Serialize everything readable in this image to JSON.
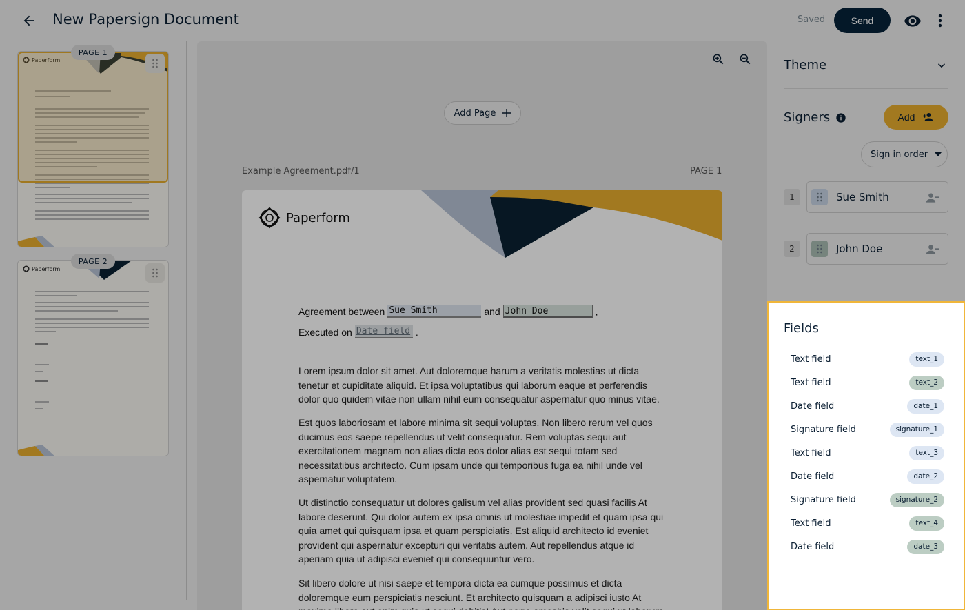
{
  "header": {
    "title": "New Papersign Document",
    "saved": "Saved",
    "send_label": "Send"
  },
  "thumbnails": [
    {
      "pill": "PAGE 1",
      "brand": "Paperform"
    },
    {
      "pill": "PAGE 2",
      "brand": "Paperform"
    }
  ],
  "viewer": {
    "add_page_label": "Add Page",
    "file_label": "Example Agreement.pdf/1",
    "page_label": "PAGE 1",
    "brand": "Paperform",
    "agreement_prefix": "Agreement between",
    "agreement_and": "and",
    "agreement_suffix": ",",
    "field_signer1": "Sue Smith",
    "field_signer2": "John Doe",
    "executed_prefix": "Executed on",
    "field_date": "Date field",
    "executed_suffix": ".",
    "paragraphs": [
      "Lorem ipsum dolor sit amet. Aut doloremque harum a veritatis molestias ut dicta tenetur et cupiditate aliquid. Et ipsa voluptatibus qui laborum eaque et perferendis dolor quo quidem vitae non ullam nihil eum consequatur aspernatur quo minus vitae.",
      "Est quos laboriosam et labore minima sit sequi voluptas. Non libero rerum vel quos ducimus eos saepe repellendus ut velit consequatur. Rem voluptas sequi aut exercitationem magnam non alias dicta eos dolor alias est sequi totam sed necessitatibus architecto. Cum ipsam unde qui temporibus fuga ea nihil unde vel aspernatur voluptatem.",
      "Ut distinctio consequatur ut dolores galisum vel alias provident sed quasi facilis At labore deserunt. Qui dolor autem ex ipsa omnis ut molestiae impedit et quam ipsa qui quia amet qui quisquam ipsa et quam perspiciatis. Est aliquid architecto id eveniet provident qui aspernatur excepturi qui veritatis autem. Aut repellendus atque id aperiam quia ut adipisci eveniet qui consequuntur vero.",
      "Sit libero dolore ut nisi saepe et tempora dicta ea cumque possimus et dicta doloremque eum perspiciatis nesciunt. Et architecto quisquam a adipisci iusto At maxime libero aut enim quia ut sequi debitis! Aut porro ameshis velit sequi ut laborum"
    ]
  },
  "theme": {
    "title": "Theme"
  },
  "signers": {
    "title": "Signers",
    "add_label": "Add",
    "order_label": "Sign in order",
    "list": [
      {
        "num": "1",
        "name": "Sue Smith",
        "color": "#c7d4e6"
      },
      {
        "num": "2",
        "name": "John Doe",
        "color": "#a9bdb3"
      }
    ]
  },
  "fields": {
    "title": "Fields",
    "items": [
      {
        "label": "Text field",
        "tag": "text_1",
        "color": "#dde6f3"
      },
      {
        "label": "Text field",
        "tag": "text_2",
        "color": "#bccdc3"
      },
      {
        "label": "Date field",
        "tag": "date_1",
        "color": "#dde6f3"
      },
      {
        "label": "Signature field",
        "tag": "signature_1",
        "color": "#dde6f3"
      },
      {
        "label": "Text field",
        "tag": "text_3",
        "color": "#dde6f3"
      },
      {
        "label": "Date field",
        "tag": "date_2",
        "color": "#dde6f3"
      },
      {
        "label": "Signature field",
        "tag": "signature_2",
        "color": "#bccdc3"
      },
      {
        "label": "Text field",
        "tag": "text_4",
        "color": "#bccdc3"
      },
      {
        "label": "Date field",
        "tag": "date_3",
        "color": "#bccdc3"
      }
    ]
  }
}
